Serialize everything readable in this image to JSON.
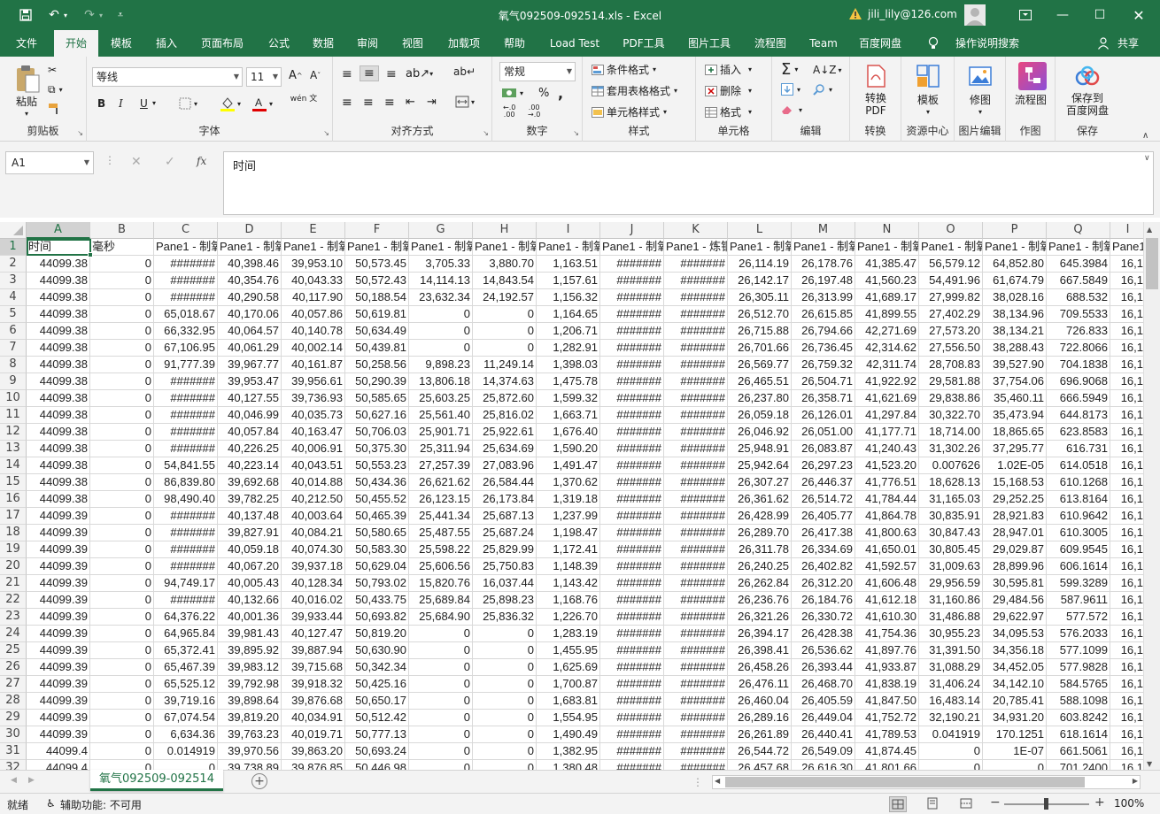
{
  "window": {
    "title": "氧气092509-092514.xls  -  Excel",
    "user": "jili_lily@126.com"
  },
  "tabs": [
    "文件",
    "开始",
    "模板",
    "插入",
    "页面布局",
    "公式",
    "数据",
    "审阅",
    "视图",
    "加载项",
    "帮助",
    "Load Test",
    "PDF工具",
    "图片工具",
    "流程图",
    "Team",
    "百度网盘"
  ],
  "active_tab": "开始",
  "tell_me": "操作说明搜索",
  "share": "共享",
  "ribbon": {
    "clipboard": {
      "label": "剪贴板",
      "paste": "粘贴"
    },
    "font": {
      "label": "字体",
      "name": "等线",
      "size": "11",
      "bold": "B",
      "italic": "I",
      "underline": "U",
      "wen": "wén 文"
    },
    "align": {
      "label": "对齐方式"
    },
    "number": {
      "label": "数字",
      "format": "常规",
      "percent": "%",
      "comma": ","
    },
    "styles": {
      "label": "样式",
      "cond": "条件格式",
      "table": "套用表格格式",
      "cell": "单元格样式"
    },
    "cells": {
      "label": "单元格",
      "insert": "插入",
      "delete": "删除",
      "format": "格式"
    },
    "editing": {
      "label": "编辑",
      "sum": "Σ"
    },
    "convert": {
      "label": "转换",
      "btn": "转换\nPDF"
    },
    "resource": {
      "label": "资源中心",
      "btn": "模板"
    },
    "imgedit": {
      "label": "图片编辑",
      "btn": "修图"
    },
    "draw": {
      "label": "作图",
      "btn": "流程图"
    },
    "save": {
      "label": "保存",
      "btn": "保存到\n百度网盘"
    }
  },
  "formula": {
    "namebox": "A1",
    "fx": "fx",
    "content": "时间"
  },
  "columns": [
    "A",
    "B",
    "C",
    "D",
    "E",
    "F",
    "G",
    "H",
    "I",
    "J",
    "K",
    "L",
    "M",
    "N",
    "O",
    "P",
    "Q",
    "I"
  ],
  "rows": [
    [
      "1",
      "时间",
      "毫秒",
      "Pane1 - 制氧",
      "Pane1 - 制氧",
      "Pane1 - 制氧",
      "Pane1 - 制氧",
      "Pane1 - 制氧",
      "Pane1 - 制氧",
      "Pane1 - 制氧",
      "Pane1 - 制氧",
      "Pane1 - 炼钢",
      "Pane1 - 制氧",
      "Pane1 - 制氧",
      "Pane1 - 制氧",
      "Pane1 - 制氧",
      "Pane1 - 制氧",
      "Pane1 - 制氧",
      "Pane1"
    ],
    [
      "2",
      "44099.38",
      "0",
      "#######",
      "40,398.46",
      "39,953.10",
      "50,573.45",
      "3,705.33",
      "3,880.70",
      "1,163.51",
      "#######",
      "#######",
      "26,114.19",
      "26,178.76",
      "41,385.47",
      "56,579.12",
      "64,852.80",
      "645.3984",
      "16,1"
    ],
    [
      "3",
      "44099.38",
      "0",
      "#######",
      "40,354.76",
      "40,043.33",
      "50,572.43",
      "14,114.13",
      "14,843.54",
      "1,157.61",
      "#######",
      "#######",
      "26,142.17",
      "26,197.48",
      "41,560.23",
      "54,491.96",
      "61,674.79",
      "667.5849",
      "16,1"
    ],
    [
      "4",
      "44099.38",
      "0",
      "#######",
      "40,290.58",
      "40,117.90",
      "50,188.54",
      "23,632.34",
      "24,192.57",
      "1,156.32",
      "#######",
      "#######",
      "26,305.11",
      "26,313.99",
      "41,689.17",
      "27,999.82",
      "38,028.16",
      "688.532",
      "16,1"
    ],
    [
      "5",
      "44099.38",
      "0",
      "65,018.67",
      "40,170.06",
      "40,057.86",
      "50,619.81",
      "0",
      "0",
      "1,164.65",
      "#######",
      "#######",
      "26,512.70",
      "26,615.85",
      "41,899.55",
      "27,402.29",
      "38,134.96",
      "709.5533",
      "16,1"
    ],
    [
      "6",
      "44099.38",
      "0",
      "66,332.95",
      "40,064.57",
      "40,140.78",
      "50,634.49",
      "0",
      "0",
      "1,206.71",
      "#######",
      "#######",
      "26,715.88",
      "26,794.66",
      "42,271.69",
      "27,573.20",
      "38,134.21",
      "726.833",
      "16,1"
    ],
    [
      "7",
      "44099.38",
      "0",
      "67,106.95",
      "40,061.29",
      "40,002.14",
      "50,439.81",
      "0",
      "0",
      "1,282.91",
      "#######",
      "#######",
      "26,701.66",
      "26,736.45",
      "42,314.62",
      "27,556.50",
      "38,288.43",
      "722.8066",
      "16,1"
    ],
    [
      "8",
      "44099.38",
      "0",
      "91,777.39",
      "39,967.77",
      "40,161.87",
      "50,258.56",
      "9,898.23",
      "11,249.14",
      "1,398.03",
      "#######",
      "#######",
      "26,569.77",
      "26,759.32",
      "42,311.74",
      "28,708.83",
      "39,527.90",
      "704.1838",
      "16,1"
    ],
    [
      "9",
      "44099.38",
      "0",
      "#######",
      "39,953.47",
      "39,956.61",
      "50,290.39",
      "13,806.18",
      "14,374.63",
      "1,475.78",
      "#######",
      "#######",
      "26,465.51",
      "26,504.71",
      "41,922.92",
      "29,581.88",
      "37,754.06",
      "696.9068",
      "16,1"
    ],
    [
      "10",
      "44099.38",
      "0",
      "#######",
      "40,127.55",
      "39,736.93",
      "50,585.65",
      "25,603.25",
      "25,872.60",
      "1,599.32",
      "#######",
      "#######",
      "26,237.80",
      "26,358.71",
      "41,621.69",
      "29,838.86",
      "35,460.11",
      "666.5949",
      "16,1"
    ],
    [
      "11",
      "44099.38",
      "0",
      "#######",
      "40,046.99",
      "40,035.73",
      "50,627.16",
      "25,561.40",
      "25,816.02",
      "1,663.71",
      "#######",
      "#######",
      "26,059.18",
      "26,126.01",
      "41,297.84",
      "30,322.70",
      "35,473.94",
      "644.8173",
      "16,1"
    ],
    [
      "12",
      "44099.38",
      "0",
      "#######",
      "40,057.84",
      "40,163.47",
      "50,706.03",
      "25,901.71",
      "25,922.61",
      "1,676.40",
      "#######",
      "#######",
      "26,046.92",
      "26,051.00",
      "41,177.71",
      "18,714.00",
      "18,865.65",
      "623.8583",
      "16,1"
    ],
    [
      "13",
      "44099.38",
      "0",
      "#######",
      "40,226.25",
      "40,006.91",
      "50,375.30",
      "25,311.94",
      "25,634.69",
      "1,590.20",
      "#######",
      "#######",
      "25,948.91",
      "26,083.87",
      "41,240.43",
      "31,302.26",
      "37,295.77",
      "616.731",
      "16,1"
    ],
    [
      "14",
      "44099.38",
      "0",
      "54,841.55",
      "40,223.14",
      "40,043.51",
      "50,553.23",
      "27,257.39",
      "27,083.96",
      "1,491.47",
      "#######",
      "#######",
      "25,942.64",
      "26,297.23",
      "41,523.20",
      "0.007626",
      "1.02E-05",
      "614.0518",
      "16,1"
    ],
    [
      "15",
      "44099.38",
      "0",
      "86,839.80",
      "39,692.68",
      "40,014.88",
      "50,434.36",
      "26,621.62",
      "26,584.44",
      "1,370.62",
      "#######",
      "#######",
      "26,307.27",
      "26,446.37",
      "41,776.51",
      "18,628.13",
      "15,168.53",
      "610.1268",
      "16,1"
    ],
    [
      "16",
      "44099.38",
      "0",
      "98,490.40",
      "39,782.25",
      "40,212.50",
      "50,455.52",
      "26,123.15",
      "26,173.84",
      "1,319.18",
      "#######",
      "#######",
      "26,361.62",
      "26,514.72",
      "41,784.44",
      "31,165.03",
      "29,252.25",
      "613.8164",
      "16,1"
    ],
    [
      "17",
      "44099.39",
      "0",
      "#######",
      "40,137.48",
      "40,003.64",
      "50,465.39",
      "25,441.34",
      "25,687.13",
      "1,237.99",
      "#######",
      "#######",
      "26,428.99",
      "26,405.77",
      "41,864.78",
      "30,835.91",
      "28,921.83",
      "610.9642",
      "16,1"
    ],
    [
      "18",
      "44099.39",
      "0",
      "#######",
      "39,827.91",
      "40,084.21",
      "50,580.65",
      "25,487.55",
      "25,687.24",
      "1,198.47",
      "#######",
      "#######",
      "26,289.70",
      "26,417.38",
      "41,800.63",
      "30,847.43",
      "28,947.01",
      "610.3005",
      "16,1"
    ],
    [
      "19",
      "44099.39",
      "0",
      "#######",
      "40,059.18",
      "40,074.30",
      "50,583.30",
      "25,598.22",
      "25,829.99",
      "1,172.41",
      "#######",
      "#######",
      "26,311.78",
      "26,334.69",
      "41,650.01",
      "30,805.45",
      "29,029.87",
      "609.9545",
      "16,1"
    ],
    [
      "20",
      "44099.39",
      "0",
      "#######",
      "40,067.20",
      "39,937.18",
      "50,629.04",
      "25,606.56",
      "25,750.83",
      "1,148.39",
      "#######",
      "#######",
      "26,240.25",
      "26,402.82",
      "41,592.57",
      "31,009.63",
      "28,899.96",
      "606.1614",
      "16,1"
    ],
    [
      "21",
      "44099.39",
      "0",
      "94,749.17",
      "40,005.43",
      "40,128.34",
      "50,793.02",
      "15,820.76",
      "16,037.44",
      "1,143.42",
      "#######",
      "#######",
      "26,262.84",
      "26,312.20",
      "41,606.48",
      "29,956.59",
      "30,595.81",
      "599.3289",
      "16,1"
    ],
    [
      "22",
      "44099.39",
      "0",
      "#######",
      "40,132.66",
      "40,016.02",
      "50,433.75",
      "25,689.84",
      "25,898.23",
      "1,168.76",
      "#######",
      "#######",
      "26,236.76",
      "26,184.76",
      "41,612.18",
      "31,160.86",
      "29,484.56",
      "587.9611",
      "16,1"
    ],
    [
      "23",
      "44099.39",
      "0",
      "64,376.22",
      "40,001.36",
      "39,933.44",
      "50,693.82",
      "25,684.90",
      "25,836.32",
      "1,226.70",
      "#######",
      "#######",
      "26,321.26",
      "26,330.72",
      "41,610.30",
      "31,486.88",
      "29,622.97",
      "577.572",
      "16,1"
    ],
    [
      "24",
      "44099.39",
      "0",
      "64,965.84",
      "39,981.43",
      "40,127.47",
      "50,819.20",
      "0",
      "0",
      "1,283.19",
      "#######",
      "#######",
      "26,394.17",
      "26,428.38",
      "41,754.36",
      "30,955.23",
      "34,095.53",
      "576.2033",
      "16,1"
    ],
    [
      "25",
      "44099.39",
      "0",
      "65,372.41",
      "39,895.92",
      "39,887.94",
      "50,630.90",
      "0",
      "0",
      "1,455.95",
      "#######",
      "#######",
      "26,398.41",
      "26,536.62",
      "41,897.76",
      "31,391.50",
      "34,356.18",
      "577.1099",
      "16,1"
    ],
    [
      "26",
      "44099.39",
      "0",
      "65,467.39",
      "39,983.12",
      "39,715.68",
      "50,342.34",
      "0",
      "0",
      "1,625.69",
      "#######",
      "#######",
      "26,458.26",
      "26,393.44",
      "41,933.87",
      "31,088.29",
      "34,452.05",
      "577.9828",
      "16,1"
    ],
    [
      "27",
      "44099.39",
      "0",
      "65,525.12",
      "39,792.98",
      "39,918.32",
      "50,425.16",
      "0",
      "0",
      "1,700.87",
      "#######",
      "#######",
      "26,476.11",
      "26,468.70",
      "41,838.19",
      "31,406.24",
      "34,142.10",
      "584.5765",
      "16,1"
    ],
    [
      "28",
      "44099.39",
      "0",
      "39,719.16",
      "39,898.64",
      "39,876.68",
      "50,650.17",
      "0",
      "0",
      "1,683.81",
      "#######",
      "#######",
      "26,460.04",
      "26,405.59",
      "41,847.50",
      "16,483.14",
      "20,785.41",
      "588.1098",
      "16,1"
    ],
    [
      "29",
      "44099.39",
      "0",
      "67,074.54",
      "39,819.20",
      "40,034.91",
      "50,512.42",
      "0",
      "0",
      "1,554.95",
      "#######",
      "#######",
      "26,289.16",
      "26,449.04",
      "41,752.72",
      "32,190.21",
      "34,931.20",
      "603.8242",
      "16,1"
    ],
    [
      "30",
      "44099.39",
      "0",
      "6,634.36",
      "39,763.23",
      "40,019.71",
      "50,777.13",
      "0",
      "0",
      "1,490.49",
      "#######",
      "#######",
      "26,261.89",
      "26,440.41",
      "41,789.53",
      "0.041919",
      "170.1251",
      "618.1614",
      "16,1"
    ],
    [
      "31",
      "44099.4",
      "0",
      "0.014919",
      "39,970.56",
      "39,863.20",
      "50,693.24",
      "0",
      "0",
      "1,382.95",
      "#######",
      "#######",
      "26,544.72",
      "26,549.09",
      "41,874.45",
      "0",
      "1E-07",
      "661.5061",
      "16,1"
    ],
    [
      "32",
      "44099.4",
      "0",
      "0",
      "39,738.89",
      "39,876.85",
      "50,446.98",
      "0",
      "0",
      "1,380.48",
      "#######",
      "#######",
      "26,457.68",
      "26,616.30",
      "41,801.66",
      "0",
      "0",
      "701.2400",
      "16,1"
    ]
  ],
  "sheet_tab": "氧气092509-092514",
  "status": {
    "ready": "就绪",
    "accessibility": "辅助功能: 不可用",
    "zoom": "100%"
  },
  "colors": {
    "brand": "#217346",
    "ribbon": "#f3f3f3",
    "grid": "#d9d9d9"
  }
}
